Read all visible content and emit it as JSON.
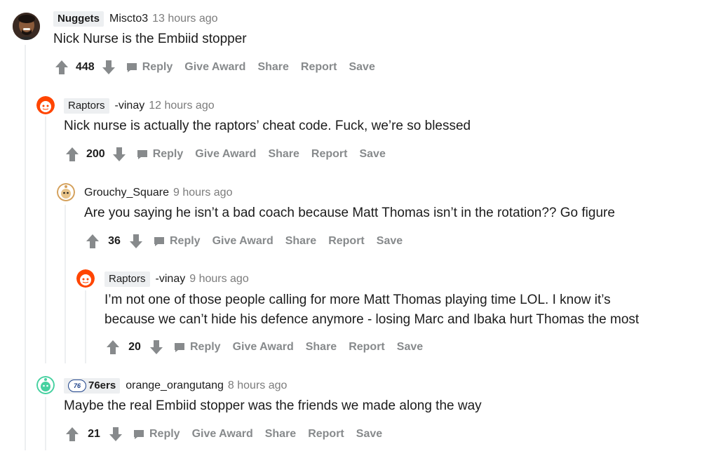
{
  "comments": [
    {
      "flair": "Nuggets",
      "username": "Miscto3",
      "timestamp": "13 hours ago",
      "body": "Nick Nurse is the Embiid stopper",
      "score": "448",
      "avatar": "photo-avatar"
    },
    {
      "flair": "Raptors",
      "username": "-vinay",
      "timestamp": "12 hours ago",
      "body": "Nick nurse is actually the raptors’ cheat code. Fuck, we’re so blessed",
      "score": "200",
      "avatar": "snoo-red-avatar"
    },
    {
      "flair": "",
      "username": "Grouchy_Square",
      "timestamp": "9 hours ago",
      "body": "Are you saying he isn’t a bad coach because Matt Thomas isn’t in the rotation?? Go figure",
      "score": "36",
      "avatar": "snoo-tan-avatar"
    },
    {
      "flair": "Raptors",
      "username": "-vinay",
      "timestamp": "9 hours ago",
      "body_lines": [
        "I’m not one of those people calling for more Matt Thomas playing time LOL. I know it’s",
        "because we can’t hide his defence anymore - losing Marc and Ibaka hurt Thomas the most"
      ],
      "score": "20",
      "avatar": "snoo-red-avatar"
    },
    {
      "flair": "76ers",
      "flair_badge": "76",
      "username": "orange_orangutang",
      "timestamp": "8 hours ago",
      "body": "Maybe the real Embiid stopper was the friends we made along the way",
      "score": "21",
      "avatar": "snoo-teal-avatar"
    }
  ],
  "actions": {
    "reply": "Reply",
    "give_award": "Give Award",
    "share": "Share",
    "report": "Report",
    "save": "Save"
  },
  "icons": {
    "upvote": "upvote-arrow-icon",
    "downvote": "downvote-arrow-icon",
    "reply": "comment-bubble-icon"
  },
  "colors": {
    "vote_arrow": "#878a8c",
    "action_text": "#878a8c",
    "flair_bg": "#edeff1",
    "timestamp": "#7c7c7c",
    "thread_line": "#edeff1",
    "snoo_red": "#ff4500",
    "snoo_teal": "#46d160",
    "sixers_blue": "#1d428a"
  }
}
